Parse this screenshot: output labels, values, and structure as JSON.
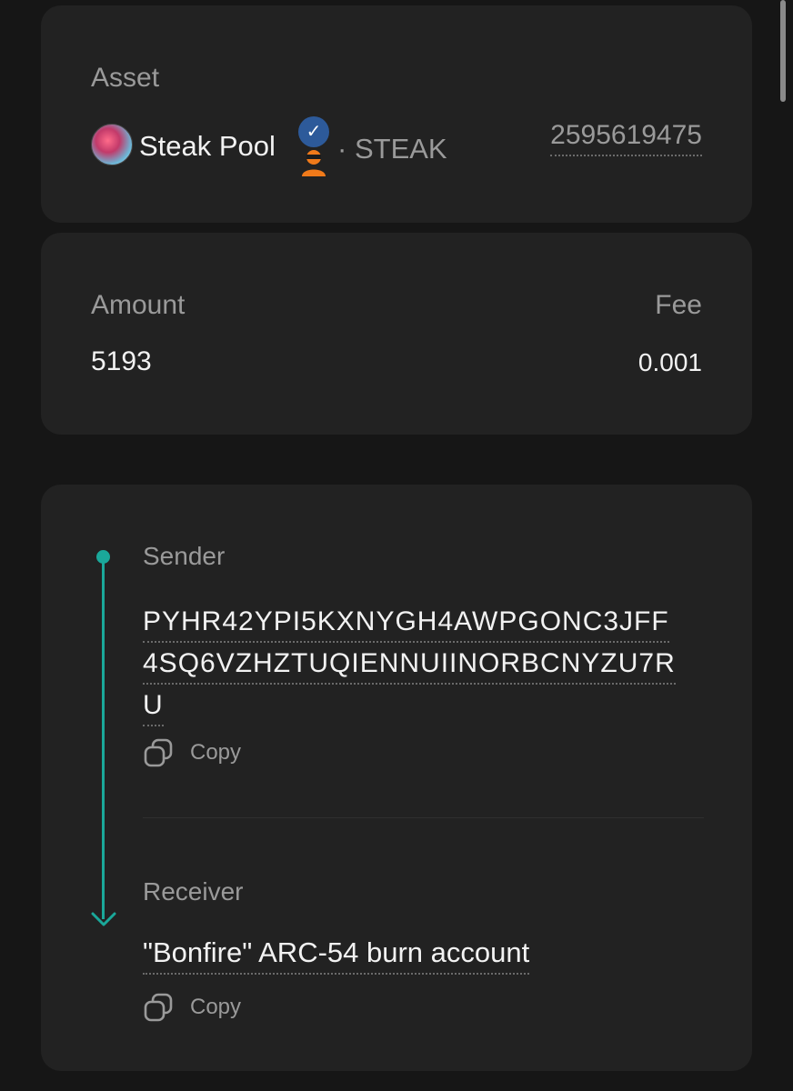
{
  "asset": {
    "label": "Asset",
    "name": "Steak Pool",
    "unit_separator": "·",
    "unit": "STEAK",
    "asset_id": "2595619475",
    "verified_mark": "✓",
    "icons": [
      "asset-logo",
      "verified-badge-icon",
      "ninja-icon"
    ]
  },
  "amount": {
    "label": "Amount",
    "value": "5193",
    "fee_label": "Fee",
    "fee_value": "0.001"
  },
  "sender": {
    "label": "Sender",
    "address_lines": [
      "PYHR42YPI5KXNYGH4AWPGONC3JFF",
      "4SQ6VZHZTUQIENNUIINORBCNYZU7R",
      "U"
    ],
    "copy_label": "Copy"
  },
  "receiver": {
    "label": "Receiver",
    "name": "\"Bonfire\" ARC-54 burn account",
    "copy_label": "Copy"
  },
  "colors": {
    "accent": "#1aa89a",
    "background": "#161616",
    "card": "#222222",
    "muted_text": "#9a9a9a"
  }
}
